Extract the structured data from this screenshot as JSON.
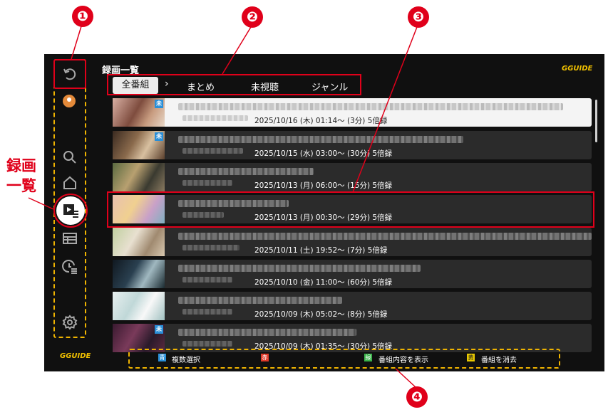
{
  "screen_title": "録画一覧",
  "logo_text": "GGUIDE",
  "tabs": {
    "active": "全番組",
    "separator": "›",
    "items": [
      "まとめ",
      "未視聴",
      "ジャンル"
    ]
  },
  "unseen_badge": "未",
  "recordings": [
    {
      "date": "2025/10/16 (木) 01:14〜 (3分)  5倍録",
      "unseen": true,
      "selected": true
    },
    {
      "date": "2025/10/15 (水) 03:00〜 (30分)  5倍録",
      "unseen": true,
      "selected": false
    },
    {
      "date": "2025/10/13 (月) 06:00〜 (15分)  5倍録",
      "unseen": false,
      "selected": false
    },
    {
      "date": "2025/10/13 (月) 00:30〜 (29分)  5倍録",
      "unseen": false,
      "selected": false
    },
    {
      "date": "2025/10/11 (土) 19:52〜 (7分)  5倍録",
      "unseen": false,
      "selected": false
    },
    {
      "date": "2025/10/10 (金) 11:00〜 (60分)  5倍録",
      "unseen": false,
      "selected": false
    },
    {
      "date": "2025/10/09 (木) 05:02〜 (8分)  5倍録",
      "unseen": false,
      "selected": false
    },
    {
      "date": "2025/10/09 (木) 01:35〜 (30分)  5倍録",
      "unseen": true,
      "selected": false
    }
  ],
  "footer": [
    {
      "key": "青",
      "label": "複数選択",
      "color": "#2a8fd8"
    },
    {
      "key": "赤",
      "label": "",
      "color": "#e03a2a"
    },
    {
      "key": "緑",
      "label": "番組内容を表示",
      "color": "#3ab34a"
    },
    {
      "key": "黄",
      "label": "番組を消去",
      "color": "#e8c800"
    }
  ],
  "annotations": {
    "n1": "❶",
    "n2": "❷",
    "n3": "❸",
    "n4": "❹",
    "side_label_1": "録画",
    "side_label_2": "一覧"
  },
  "colors": {
    "accent_red": "#e0001a",
    "dash_yellow": "#f0b400",
    "logo_yellow": "#f0c000"
  }
}
